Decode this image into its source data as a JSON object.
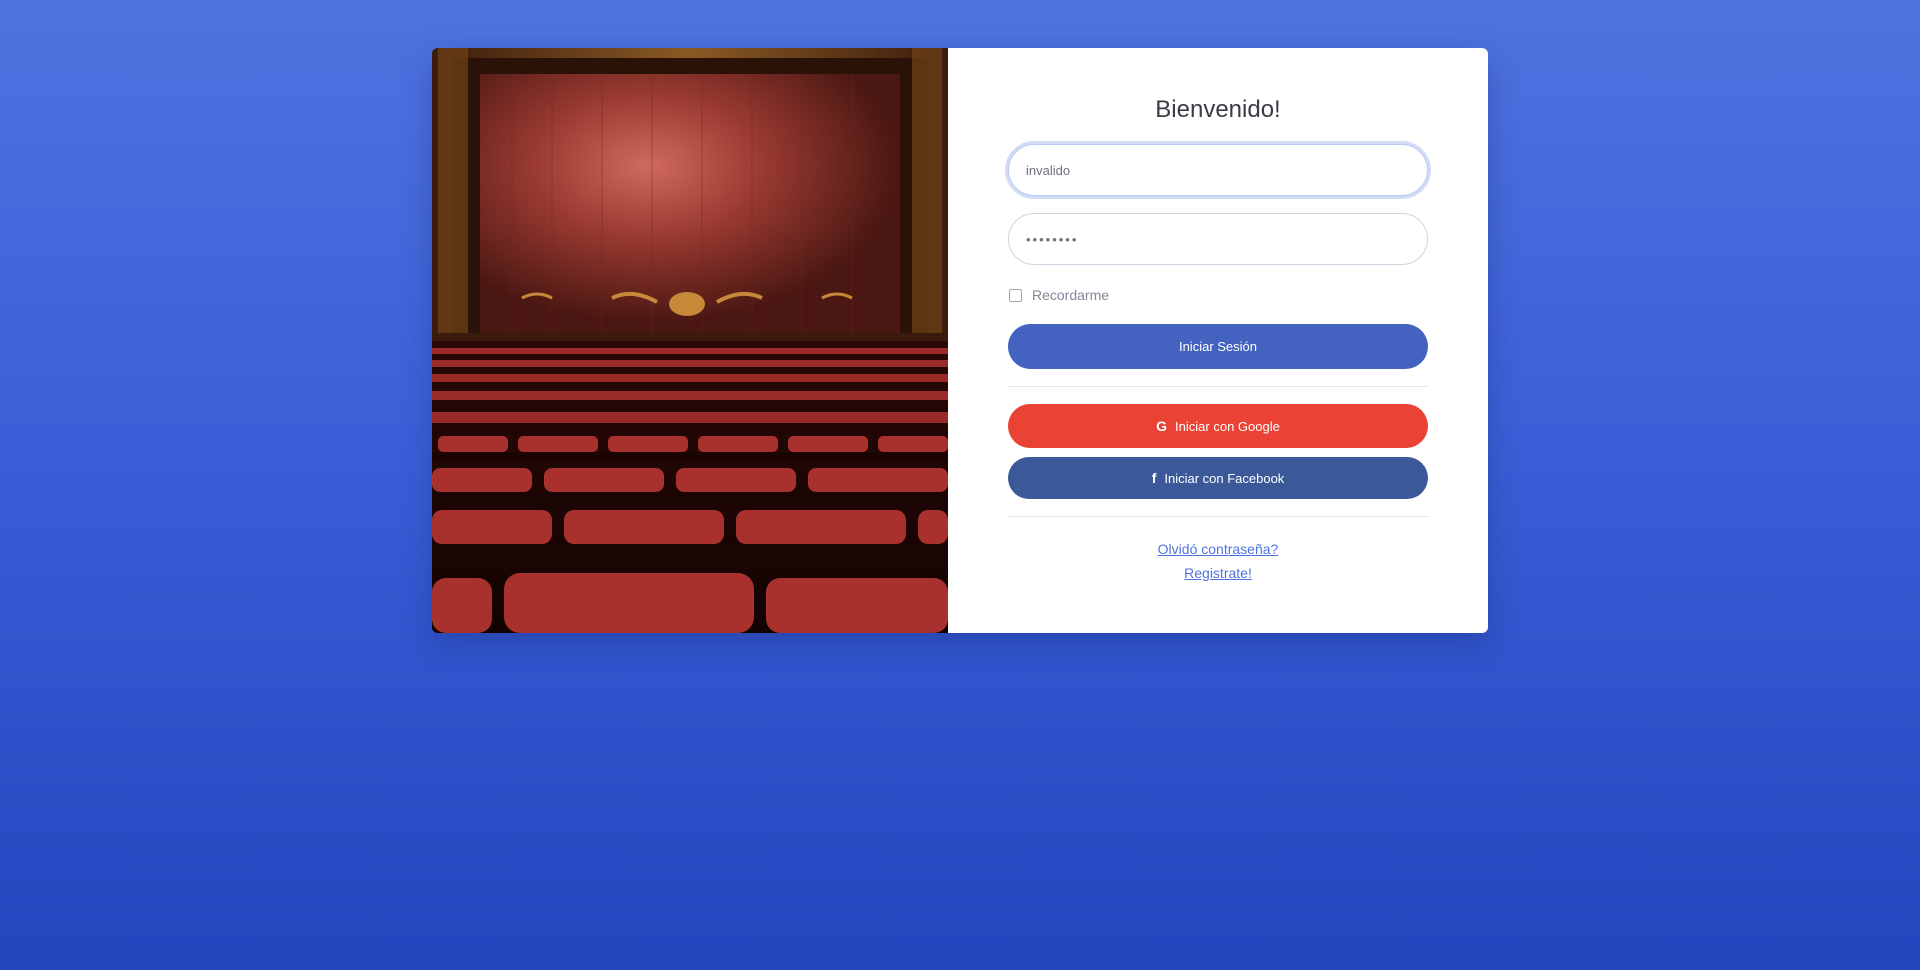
{
  "login": {
    "title": "Bienvenido!",
    "username_value": "invalido",
    "password_value": "••••••••",
    "remember_label": "Recordarme",
    "remember_checked": false,
    "submit_label": "Iniciar Sesión",
    "google_label": "Iniciar con Google",
    "facebook_label": "Iniciar con Facebook",
    "forgot_label": "Olvidó contraseña?",
    "register_label": "Registrate!"
  },
  "icons": {
    "google": "google-icon",
    "facebook": "facebook-icon"
  },
  "colors": {
    "background_top": "#4e73df",
    "background_bottom": "#2246be",
    "primary": "#4462c0",
    "google": "#ea4335",
    "facebook": "#3b5998",
    "link": "#4e73df"
  }
}
